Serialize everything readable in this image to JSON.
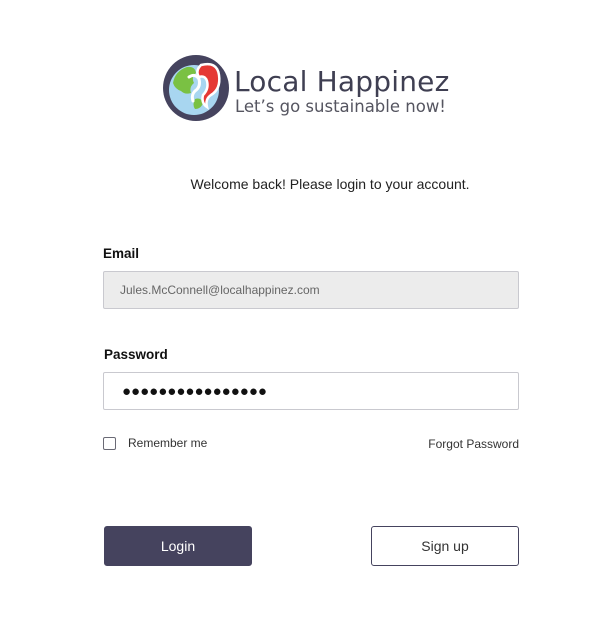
{
  "brand": {
    "name": "Local Happinez",
    "tagline": "Let’s go sustainable now!",
    "colors": {
      "primary": "#45435e",
      "globe_ocean": "#a8d6f0",
      "globe_land": "#7ac143",
      "accent_red": "#e53935"
    }
  },
  "welcome_text": "Welcome back! Please login to your account.",
  "email": {
    "label": "Email",
    "value": "Jules.McConnell@localhappinez.com"
  },
  "password": {
    "label": "Password",
    "value": "●●●●●●●●●●●●●●●●"
  },
  "remember_me": {
    "label": "Remember me",
    "checked": false
  },
  "forgot_password": "Forgot Password",
  "buttons": {
    "login": "Login",
    "signup": "Sign up"
  }
}
